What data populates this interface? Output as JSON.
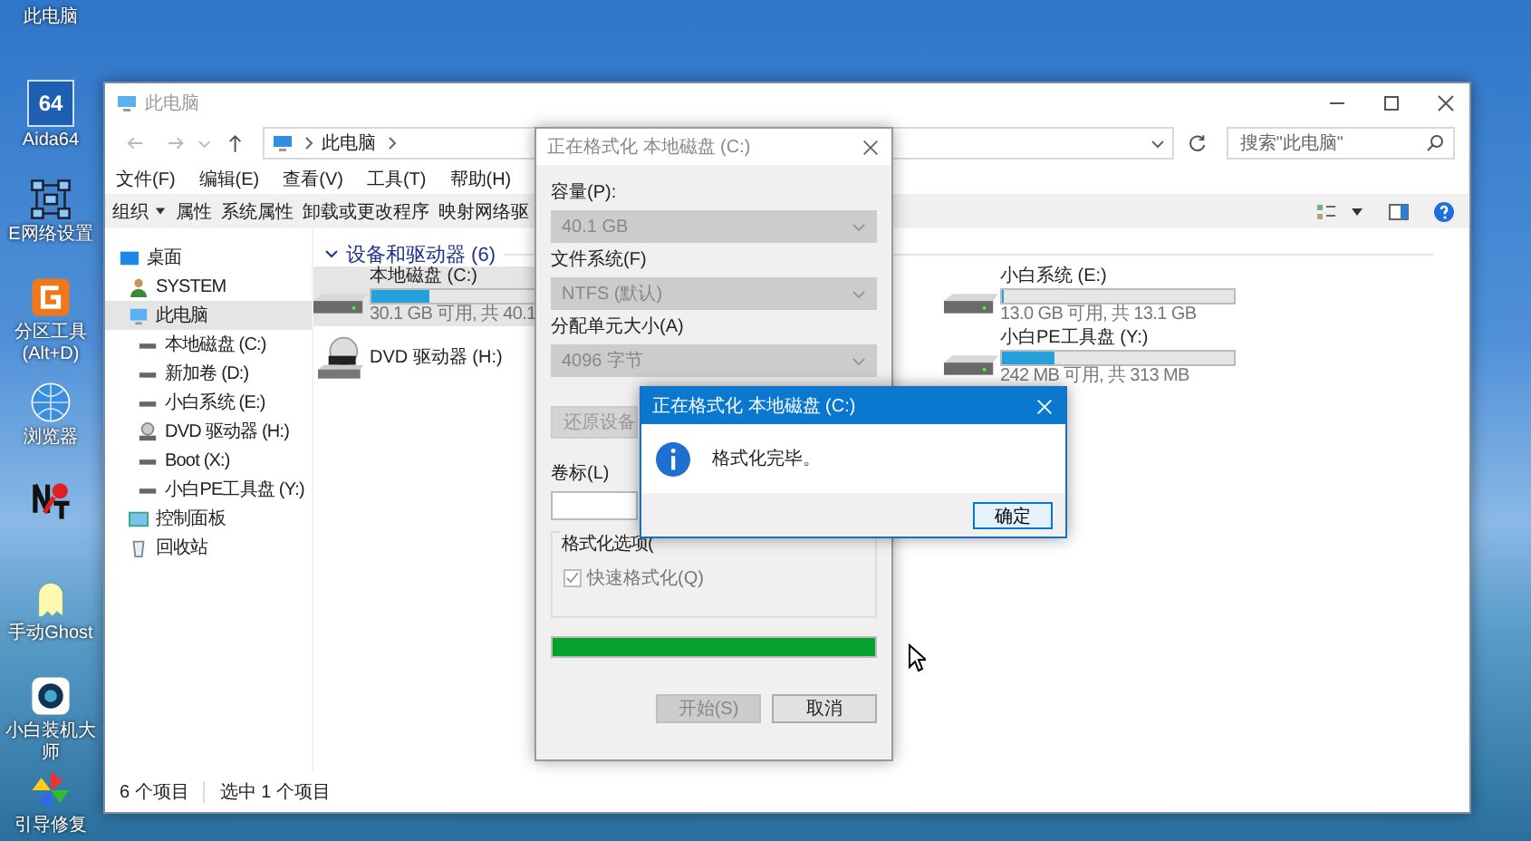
{
  "desktop_icons": [
    {
      "label": "此电脑",
      "kind": "pc"
    },
    {
      "label": "Aida64",
      "kind": "aida",
      "badge": "64"
    },
    {
      "label": "E网络设置",
      "kind": "network"
    },
    {
      "label": "分区工具 (Alt+D)",
      "kind": "partition"
    },
    {
      "label": "浏览器",
      "kind": "globe"
    },
    {
      "kind": "key"
    },
    {
      "label": "手动Ghost",
      "kind": "ghost"
    },
    {
      "label": "小白装机大师",
      "kind": "installer"
    },
    {
      "label": "引导修复",
      "kind": "pinwheel"
    }
  ],
  "explorer": {
    "title": "此电脑",
    "breadcrumb": "此电脑",
    "search": {
      "placeholder": "搜索\"此电脑\""
    },
    "menu": [
      "文件(F)",
      "编辑(E)",
      "查看(V)",
      "工具(T)",
      "帮助(H)"
    ],
    "toolbar": [
      {
        "label": "组织",
        "kind": "dropdown"
      },
      {
        "label": "属性",
        "kind": "plain"
      },
      {
        "label": "系统属性",
        "kind": "plain"
      },
      {
        "label": "卸载或更改程序",
        "kind": "plain"
      },
      {
        "label": "映射网络驱",
        "kind": "plain"
      }
    ],
    "nav": [
      {
        "label": "桌面",
        "kind": "desktop",
        "selected": false,
        "children": [
          {
            "label": "SYSTEM",
            "kind": "user",
            "selected": false
          },
          {
            "label": "此电脑",
            "kind": "pc",
            "selected": true,
            "children": [
              {
                "label": "本地磁盘 (C:)",
                "kind": "drive",
                "selected": false
              },
              {
                "label": "新加卷 (D:)",
                "kind": "drive",
                "selected": false
              },
              {
                "label": "小白系统 (E:)",
                "kind": "drive",
                "selected": false
              },
              {
                "label": "DVD 驱动器 (H:)",
                "kind": "dvd",
                "selected": false
              },
              {
                "label": "Boot (X:)",
                "kind": "drive",
                "selected": false
              },
              {
                "label": "小白PE工具盘 (Y:)",
                "kind": "drive",
                "selected": false
              }
            ]
          },
          {
            "label": "控制面板",
            "kind": "panel",
            "selected": false
          },
          {
            "label": "回收站",
            "kind": "bin",
            "selected": false
          }
        ]
      }
    ],
    "section": "设备和驱动器 (6)",
    "drive_columns": [
      [
        {
          "name": "本地磁盘 (C:)",
          "kind": "disk",
          "level": 0.25,
          "space": "30.1 GB 可用, 共 40.1",
          "selected": true
        },
        {
          "name": "DVD 驱动器 (H:)",
          "kind": "dvd",
          "selected": false
        }
      ],
      [
        {
          "name": "小白系统 (E:)",
          "kind": "disk",
          "level": 0.01,
          "space": "13.0 GB 可用, 共 13.1 GB",
          "selected": false
        },
        {
          "name": "小白PE工具盘 (Y:)",
          "kind": "disk",
          "level": 0.23,
          "space": "242 MB 可用, 共 313 MB",
          "selected": false
        }
      ]
    ],
    "status": [
      "6 个项目",
      "选中 1 个项目"
    ]
  },
  "format_dialog": {
    "title": "正在格式化 本地磁盘 (C:)",
    "fields": [
      {
        "label": "容量(P):",
        "value": "40.1 GB",
        "disabled": true
      },
      {
        "label": "文件系统(F)",
        "value": "NTFS (默认)",
        "disabled": true
      },
      {
        "label": "分配单元大小(A)",
        "value": "4096 字节",
        "disabled": true
      }
    ],
    "restore_button": "还原设备",
    "volume_label": "卷标(L)",
    "options_legend": "格式化选项(",
    "quick_format": {
      "label": "快速格式化(Q)",
      "checked": true,
      "disabled": true
    },
    "progress": {
      "level": 1
    },
    "buttons": [
      {
        "label": "开始(S)",
        "disabled": true
      },
      {
        "label": "取消",
        "disabled": false
      }
    ]
  },
  "message_box": {
    "title": "正在格式化 本地磁盘 (C:)",
    "text": "格式化完毕。",
    "button": "确定"
  }
}
